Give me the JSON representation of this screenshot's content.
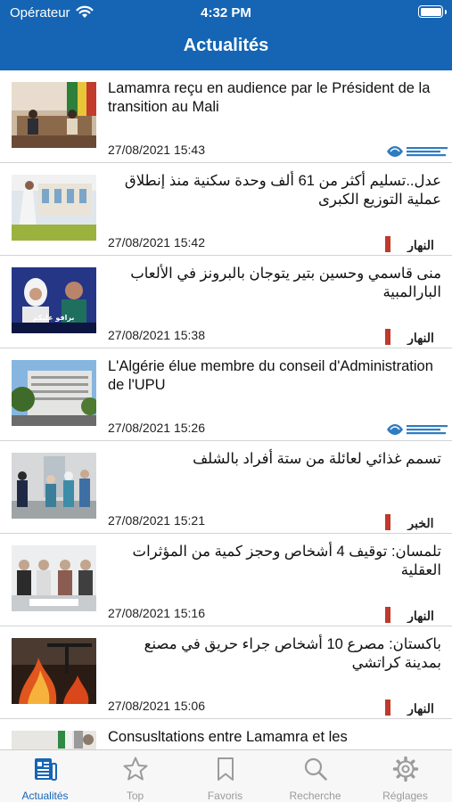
{
  "status_bar": {
    "carrier": "Opérateur",
    "time": "4:32 PM"
  },
  "nav": {
    "title": "Actualités"
  },
  "articles": [
    {
      "title": "Lamamra reçu en audience par le Président de la transition au Mali",
      "date": "27/08/2021 15:43",
      "source_icon": "aps-logo-icon"
    },
    {
      "title": "عدل..تسليم أكثر من 61 ألف وحدة سكنية منذ إنطلاق عملية التوزيع الكبرى",
      "date": "27/08/2021 15:42",
      "source_icon": "ennahar-logo-icon"
    },
    {
      "title": "منى قاسمي وحسين بتير يتوجان بالبرونز في الألعاب البارالمبية",
      "date": "27/08/2021 15:38",
      "source_icon": "ennahar-logo-icon",
      "thumb_caption": "برافو عليكم"
    },
    {
      "title": "L'Algérie élue membre du conseil d'Administration de l'UPU",
      "date": "27/08/2021 15:26",
      "source_icon": "aps-logo-icon"
    },
    {
      "title": "تسمم غذائي لعائلة من ستة أفراد بالشلف",
      "date": "27/08/2021 15:21",
      "source_icon": "elkhabar-logo-icon"
    },
    {
      "title": "تلمسان: توقيف 4 أشخاص وحجز كمية من المؤثرات العقلية",
      "date": "27/08/2021 15:16",
      "source_icon": "ennahar-logo-icon"
    },
    {
      "title": "باكستان: مصرع 10 أشخاص جراء حريق في مصنع بمدينة كراتشي",
      "date": "27/08/2021 15:06",
      "source_icon": "ennahar-logo-icon"
    },
    {
      "title": "Consusltations entre Lamamra et les",
      "date": "",
      "source_icon": ""
    }
  ],
  "logos": {
    "ennahar": "النهار",
    "elkhabar": "الخبر"
  },
  "tabs": [
    {
      "label": "Actualités",
      "icon": "news-icon",
      "active": true
    },
    {
      "label": "Top",
      "icon": "star-icon",
      "active": false
    },
    {
      "label": "Favoris",
      "icon": "bookmark-icon",
      "active": false
    },
    {
      "label": "Recherche",
      "icon": "magnifier-icon",
      "active": false
    },
    {
      "label": "Réglages",
      "icon": "gear-icon",
      "active": false
    }
  ],
  "colors": {
    "header": "#1565b4",
    "tab_active": "#1565b4",
    "tab_inactive": "#9b9b9b"
  }
}
